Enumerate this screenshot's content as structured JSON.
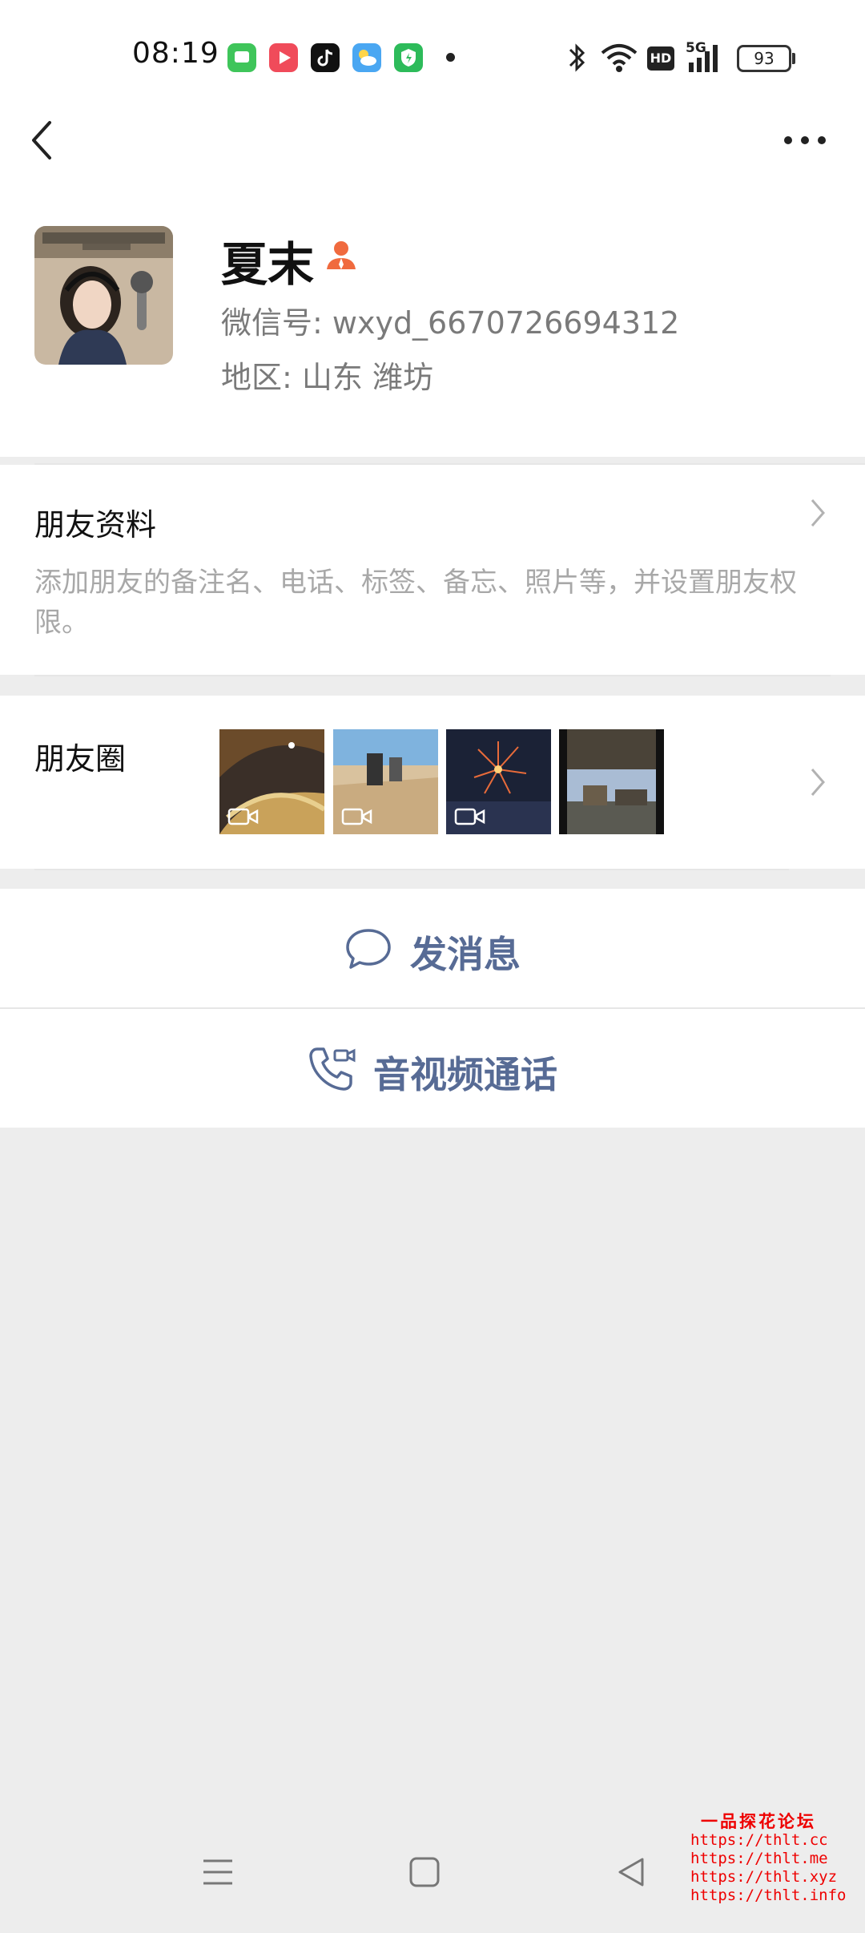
{
  "status_bar": {
    "time": "08:19",
    "apps": [
      {
        "name": "messages-app-icon",
        "color": "#3fc55a"
      },
      {
        "name": "video-app-icon",
        "color": "#f04b5a"
      },
      {
        "name": "tiktok-app-icon",
        "color": "#111111"
      },
      {
        "name": "weather-app-icon",
        "color": "#4aa7f2"
      },
      {
        "name": "security-app-icon",
        "color": "#2dbb5a"
      }
    ],
    "signal_label": "5G",
    "hd_label": "HD",
    "battery": "93"
  },
  "profile": {
    "name": "夏末",
    "wxid": "微信号: wxyd_6670726694312",
    "region": "地区: 山东  潍坊"
  },
  "friend_info": {
    "title": "朋友资料",
    "description": "添加朋友的备注名、电话、标签、备忘、照片等，并设置朋友权限。"
  },
  "moments": {
    "title": "朋友圈",
    "thumbnails": [
      {
        "name": "moment-thumb-1",
        "has_video": true
      },
      {
        "name": "moment-thumb-2",
        "has_video": true
      },
      {
        "name": "moment-thumb-3",
        "has_video": true
      },
      {
        "name": "moment-thumb-4",
        "has_video": false
      }
    ]
  },
  "actions": {
    "message": "发消息",
    "call": "音视频通话"
  },
  "watermark": {
    "title": "一品探花论坛",
    "links": [
      "https://thlt.cc",
      "https://thlt.me",
      "https://thlt.xyz",
      "https://thlt.info"
    ]
  },
  "colors": {
    "link_blue": "#576b95",
    "background": "#ededed",
    "badge_orange": "#f06a3e"
  }
}
